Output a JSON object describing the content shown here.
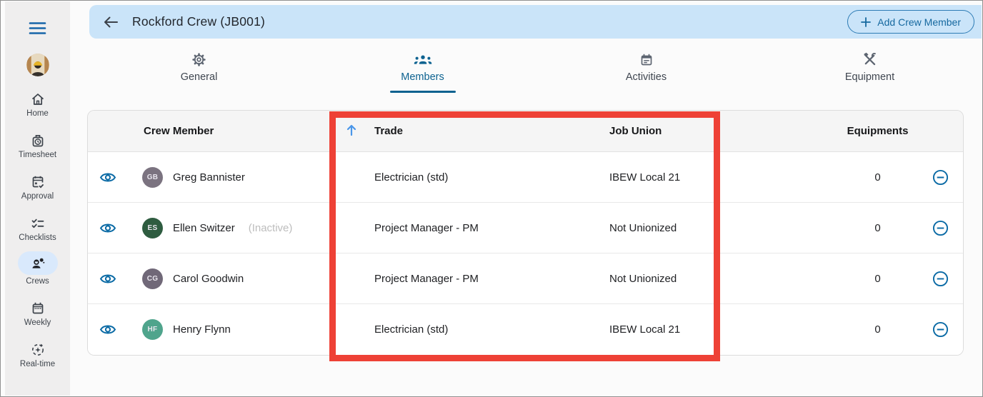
{
  "colors": {
    "accent_blue": "#0a6aa5",
    "header_bar_blue": "#cae4f9",
    "tab_active_blue": "#0d6290",
    "sort_arrow_blue": "#4a96e9",
    "annotation_red": "#ee4136",
    "inactive_gray": "#bdbdbd"
  },
  "sidebar": {
    "items": [
      {
        "label": "Home",
        "icon": "home-icon",
        "active": false
      },
      {
        "label": "Timesheet",
        "icon": "timesheet-icon",
        "active": false
      },
      {
        "label": "Approval",
        "icon": "approval-icon",
        "active": false
      },
      {
        "label": "Checklists",
        "icon": "checklists-icon",
        "active": false
      },
      {
        "label": "Crews",
        "icon": "crews-icon",
        "active": true
      },
      {
        "label": "Weekly",
        "icon": "weekly-icon",
        "active": false
      },
      {
        "label": "Real-time",
        "icon": "realtime-icon",
        "active": false
      }
    ]
  },
  "header": {
    "title": "Rockford Crew  (JB001)",
    "add_button_label": "Add Crew Member"
  },
  "tabs": [
    {
      "label": "General",
      "icon": "gear-icon",
      "active": false
    },
    {
      "label": "Members",
      "icon": "group-icon",
      "active": true
    },
    {
      "label": "Activities",
      "icon": "event-icon",
      "active": false
    },
    {
      "label": "Equipment",
      "icon": "tools-icon",
      "active": false
    }
  ],
  "table": {
    "columns": {
      "member": "Crew Member",
      "trade": "Trade",
      "union": "Job Union",
      "equipments": "Equipments"
    },
    "sorted_column": "Trade",
    "sort_direction": "ascending",
    "rows": [
      {
        "initials": "GB",
        "avatar_color": "#7b7380",
        "name": "Greg Bannister",
        "trade": "Electrician (std)",
        "union": "IBEW Local 21",
        "equipments": "0"
      },
      {
        "initials": "ES",
        "avatar_color": "#2e5c40",
        "name": "Ellen Switzer",
        "status": "(Inactive)",
        "trade": "Project Manager - PM",
        "union": "Not Unionized",
        "equipments": "0"
      },
      {
        "initials": "CG",
        "avatar_color": "#706878",
        "name": "Carol Goodwin",
        "trade": "Project Manager - PM",
        "union": "Not Unionized",
        "equipments": "0"
      },
      {
        "initials": "HF",
        "avatar_color": "#4fa48c",
        "name": "Henry Flynn",
        "trade": "Electrician (std)",
        "union": "IBEW Local 21",
        "equipments": "0"
      }
    ]
  }
}
